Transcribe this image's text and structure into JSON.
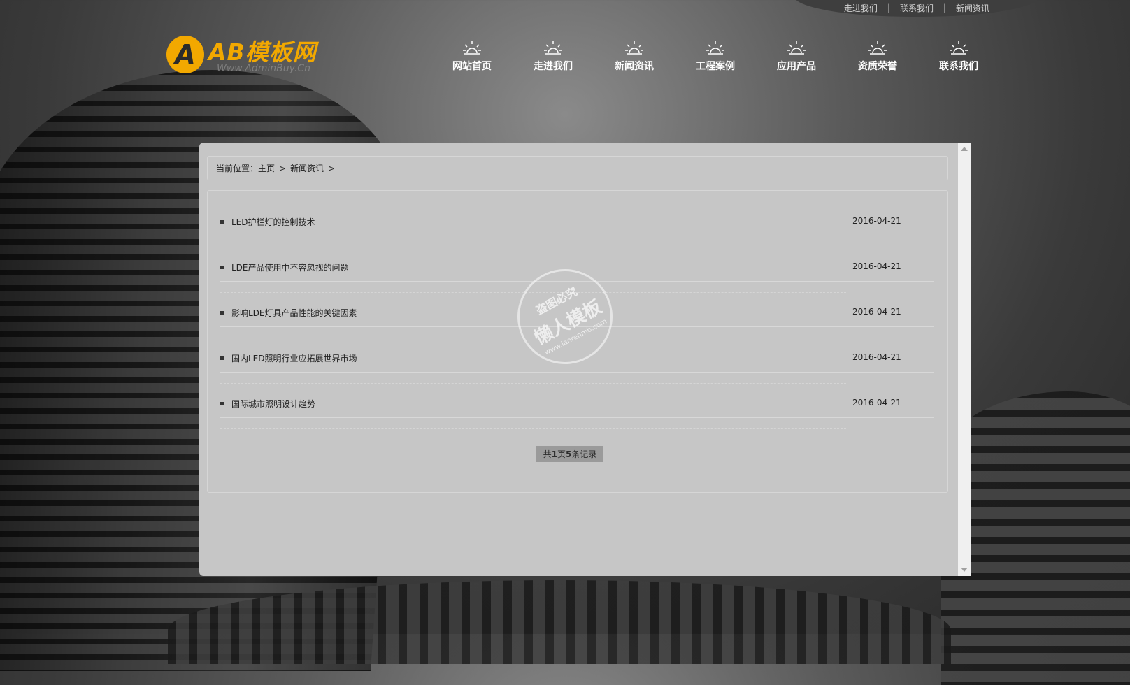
{
  "top_links": [
    "走进我们",
    "联系我们",
    "新闻资讯"
  ],
  "top_link_separator": "|",
  "logo": {
    "badge_letter": "A",
    "text": "AB模板网",
    "subtext": "Www.AdminBuy.Cn"
  },
  "nav": [
    {
      "label": "网站首页",
      "icon": "sun-icon"
    },
    {
      "label": "走进我们",
      "icon": "sun-icon"
    },
    {
      "label": "新闻资讯",
      "icon": "sun-icon"
    },
    {
      "label": "工程案例",
      "icon": "sun-icon"
    },
    {
      "label": "应用产品",
      "icon": "sun-icon"
    },
    {
      "label": "资质荣誉",
      "icon": "sun-icon"
    },
    {
      "label": "联系我们",
      "icon": "sun-icon"
    }
  ],
  "breadcrumb": {
    "prefix": "当前位置：",
    "home": "主页",
    "current": "新闻资讯",
    "separator": ">"
  },
  "news": [
    {
      "title": "LED护栏灯的控制技术",
      "date": "2016-04-21"
    },
    {
      "title": "LDE产品使用中不容忽视的问题",
      "date": "2016-04-21"
    },
    {
      "title": "影响LDE灯具产品性能的关键因素",
      "date": "2016-04-21"
    },
    {
      "title": "国内LED照明行业应拓展世界市场",
      "date": "2016-04-21"
    },
    {
      "title": "国际城市照明设计趋势",
      "date": "2016-04-21"
    }
  ],
  "pager": {
    "prefix": "共 ",
    "pages": "1",
    "mid": "页",
    "records": "5",
    "suffix": "条记录"
  },
  "watermark": {
    "top": "盗图必究",
    "main": "懒人模板",
    "url": "www.lanrenmb.com"
  },
  "colors": {
    "accent": "#f2a800",
    "panel": "#c6c6c6",
    "pager_bg": "#9a9a9a"
  }
}
